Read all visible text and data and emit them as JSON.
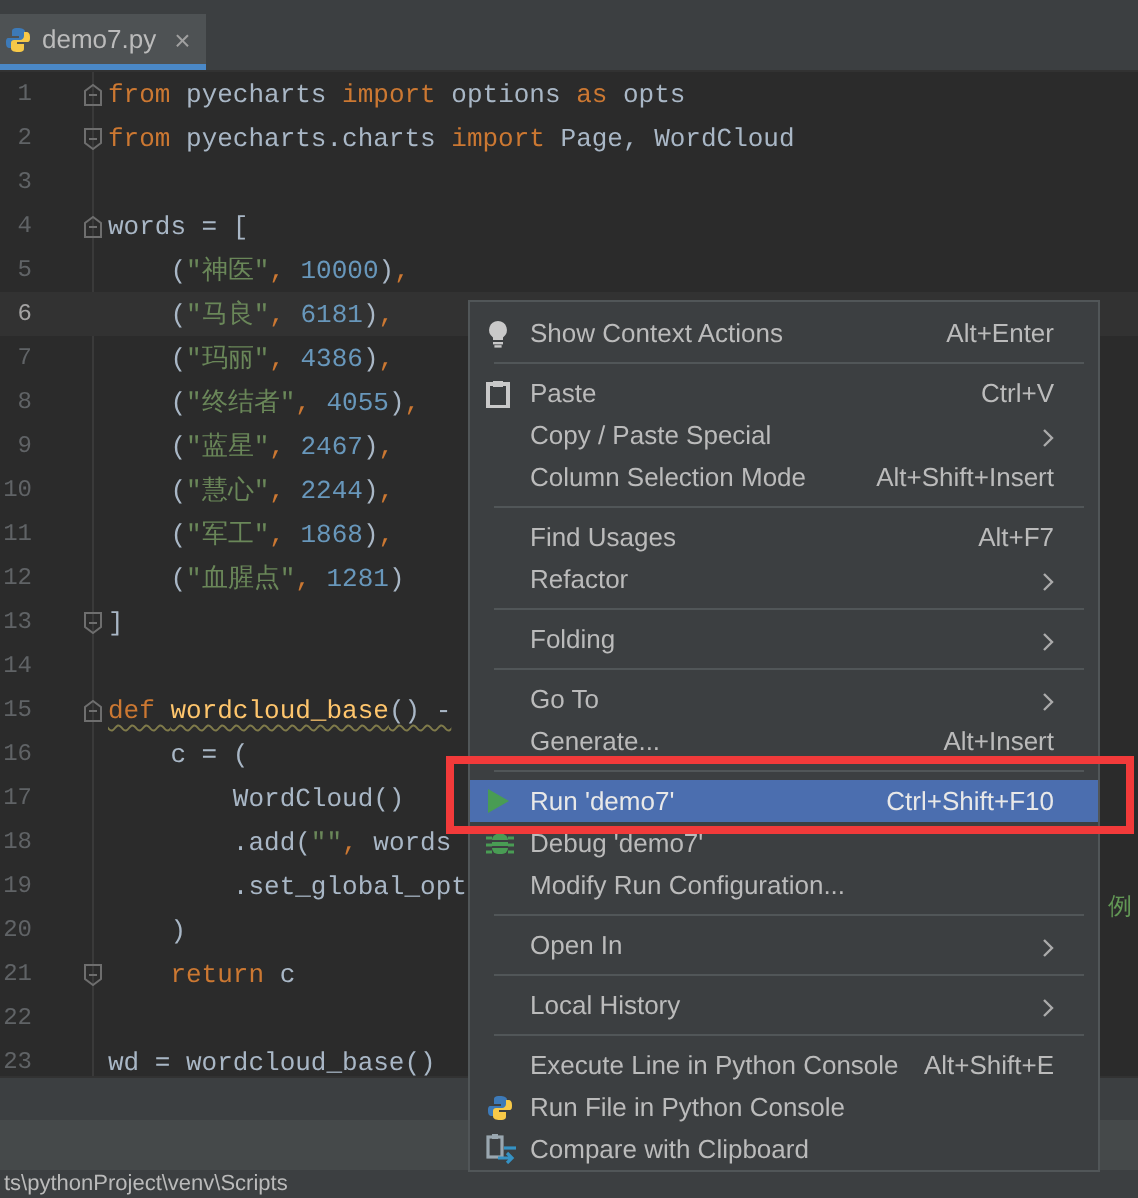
{
  "tab": {
    "title": "demo7.py",
    "close": "×",
    "selected": true
  },
  "editor": {
    "lines": [
      {
        "number": "1",
        "fold_start": true,
        "tokens": [
          {
            "kind": "keyword",
            "text": "from"
          },
          {
            "kind": "plain",
            "text": " pyecharts "
          },
          {
            "kind": "keyword",
            "text": "import"
          },
          {
            "kind": "plain",
            "text": " options "
          },
          {
            "kind": "keyword",
            "text": "as"
          },
          {
            "kind": "plain",
            "text": " opts"
          }
        ]
      },
      {
        "number": "2",
        "fold_end": true,
        "tokens": [
          {
            "kind": "keyword",
            "text": "from"
          },
          {
            "kind": "plain",
            "text": " pyecharts.charts "
          },
          {
            "kind": "keyword",
            "text": "import"
          },
          {
            "kind": "plain",
            "text": " Page, WordCloud"
          }
        ]
      },
      {
        "number": "3"
      },
      {
        "number": "4",
        "fold_start": true,
        "tokens": [
          {
            "kind": "plain",
            "text": "words = ["
          }
        ]
      },
      {
        "number": "5",
        "tokens": [
          {
            "kind": "plain",
            "text": "    ("
          },
          {
            "kind": "string",
            "text": "\"神医\""
          },
          {
            "kind": "keyword",
            "text": ","
          },
          {
            "kind": "number",
            "text": " 10000"
          },
          {
            "kind": "plain",
            "text": ")"
          },
          {
            "kind": "keyword",
            "text": ","
          }
        ]
      },
      {
        "number": "6",
        "current": true,
        "tokens": [
          {
            "kind": "plain",
            "text": "    ("
          },
          {
            "kind": "string",
            "text": "\"马良\""
          },
          {
            "kind": "keyword",
            "text": ","
          },
          {
            "kind": "number",
            "text": " 6181"
          },
          {
            "kind": "plain",
            "text": ")"
          },
          {
            "kind": "keyword",
            "text": ","
          }
        ]
      },
      {
        "number": "7",
        "tokens": [
          {
            "kind": "plain",
            "text": "    ("
          },
          {
            "kind": "string",
            "text": "\"玛丽\""
          },
          {
            "kind": "keyword",
            "text": ","
          },
          {
            "kind": "number",
            "text": " 4386"
          },
          {
            "kind": "plain",
            "text": ")"
          },
          {
            "kind": "keyword",
            "text": ","
          }
        ]
      },
      {
        "number": "8",
        "tokens": [
          {
            "kind": "plain",
            "text": "    ("
          },
          {
            "kind": "string",
            "text": "\"终结者\""
          },
          {
            "kind": "keyword",
            "text": ","
          },
          {
            "kind": "number",
            "text": " 4055"
          },
          {
            "kind": "plain",
            "text": ")"
          },
          {
            "kind": "keyword",
            "text": ","
          }
        ]
      },
      {
        "number": "9",
        "tokens": [
          {
            "kind": "plain",
            "text": "    ("
          },
          {
            "kind": "string",
            "text": "\"蓝星\""
          },
          {
            "kind": "keyword",
            "text": ","
          },
          {
            "kind": "number",
            "text": " 2467"
          },
          {
            "kind": "plain",
            "text": ")"
          },
          {
            "kind": "keyword",
            "text": ","
          }
        ]
      },
      {
        "number": "10",
        "tokens": [
          {
            "kind": "plain",
            "text": "    ("
          },
          {
            "kind": "string",
            "text": "\"慧心\""
          },
          {
            "kind": "keyword",
            "text": ","
          },
          {
            "kind": "number",
            "text": " 2244"
          },
          {
            "kind": "plain",
            "text": ")"
          },
          {
            "kind": "keyword",
            "text": ","
          }
        ]
      },
      {
        "number": "11",
        "tokens": [
          {
            "kind": "plain",
            "text": "    ("
          },
          {
            "kind": "string",
            "text": "\"军工\""
          },
          {
            "kind": "keyword",
            "text": ","
          },
          {
            "kind": "number",
            "text": " 1868"
          },
          {
            "kind": "plain",
            "text": ")"
          },
          {
            "kind": "keyword",
            "text": ","
          }
        ]
      },
      {
        "number": "12",
        "tokens": [
          {
            "kind": "plain",
            "text": "    ("
          },
          {
            "kind": "string",
            "text": "\"血腥点\""
          },
          {
            "kind": "keyword",
            "text": ","
          },
          {
            "kind": "number",
            "text": " 1281"
          },
          {
            "kind": "plain",
            "text": ")"
          }
        ]
      },
      {
        "number": "13",
        "fold_end": true,
        "tokens": [
          {
            "kind": "plain",
            "text": "]"
          }
        ]
      },
      {
        "number": "14"
      },
      {
        "number": "15",
        "fold_start": true,
        "warning": true,
        "tokens": [
          {
            "kind": "keyword",
            "text": "def "
          },
          {
            "kind": "function",
            "text": "wordcloud_base"
          },
          {
            "kind": "plain",
            "text": "() -"
          }
        ]
      },
      {
        "number": "16",
        "tokens": [
          {
            "kind": "plain",
            "text": "    c = ("
          }
        ]
      },
      {
        "number": "17",
        "tokens": [
          {
            "kind": "plain",
            "text": "        WordCloud()"
          }
        ]
      },
      {
        "number": "18",
        "tokens": [
          {
            "kind": "plain",
            "text": "        .add("
          },
          {
            "kind": "string",
            "text": "\"\""
          },
          {
            "kind": "keyword",
            "text": ","
          },
          {
            "kind": "plain",
            "text": " words"
          }
        ]
      },
      {
        "number": "19",
        "tokens": [
          {
            "kind": "plain",
            "text": "        .set_global_opt"
          }
        ]
      },
      {
        "number": "20",
        "tokens": [
          {
            "kind": "plain",
            "text": "    )"
          }
        ]
      },
      {
        "number": "21",
        "fold_end": true,
        "tokens": [
          {
            "kind": "keyword",
            "text": "    return"
          },
          {
            "kind": "plain",
            "text": " c"
          }
        ]
      },
      {
        "number": "22"
      },
      {
        "number": "23",
        "tokens": [
          {
            "kind": "plain",
            "text": "wd = wordcloud_base()"
          }
        ]
      }
    ],
    "fragment": "例"
  },
  "status_path": "ts\\pythonProject\\venv\\Scripts",
  "context_menu": {
    "groups": [
      [
        {
          "label": "Show Context Actions",
          "shortcut": "Alt+Enter",
          "kind": "bulb",
          "selected": false
        }
      ],
      [
        {
          "label": "Paste",
          "shortcut": "Ctrl+V",
          "kind": "clipboard",
          "selected": false
        },
        {
          "label": "Copy / Paste Special",
          "submenu": true,
          "selected": false
        },
        {
          "label": "Column Selection Mode",
          "shortcut": "Alt+Shift+Insert",
          "selected": false
        }
      ],
      [
        {
          "label": "Find Usages",
          "shortcut": "Alt+F7",
          "selected": false
        },
        {
          "label": "Refactor",
          "submenu": true,
          "selected": false
        }
      ],
      [
        {
          "label": "Folding",
          "submenu": true,
          "selected": false
        }
      ],
      [
        {
          "label": "Go To",
          "submenu": true,
          "selected": false
        },
        {
          "label": "Generate...",
          "shortcut": "Alt+Insert",
          "selected": false
        }
      ],
      [
        {
          "label": "Run 'demo7'",
          "shortcut": "Ctrl+Shift+F10",
          "kind": "run",
          "selected": true
        },
        {
          "label": "Debug 'demo7'",
          "kind": "debug",
          "selected": false
        },
        {
          "label": "Modify Run Configuration...",
          "selected": false
        }
      ],
      [
        {
          "label": "Open In",
          "submenu": true,
          "selected": false
        }
      ],
      [
        {
          "label": "Local History",
          "submenu": true,
          "selected": false
        }
      ],
      [
        {
          "label": "Execute Line in Python Console",
          "shortcut": "Alt+Shift+E",
          "selected": false
        },
        {
          "label": "Run File in Python Console",
          "kind": "python",
          "selected": false
        },
        {
          "label": "Compare with Clipboard",
          "kind": "compare",
          "selected": false
        }
      ]
    ]
  }
}
